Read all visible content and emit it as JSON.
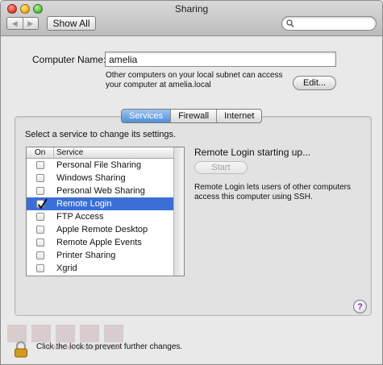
{
  "window": {
    "title": "Sharing"
  },
  "toolbar": {
    "show_all_label": "Show All",
    "search_placeholder": ""
  },
  "computer_name": {
    "label": "Computer Name:",
    "value": "amelia",
    "info_line1": "Other computers on your local subnet can access",
    "info_line2": "your computer at amelia.local",
    "edit_label": "Edit..."
  },
  "tabs": [
    {
      "label": "Services",
      "active": true
    },
    {
      "label": "Firewall",
      "active": false
    },
    {
      "label": "Internet",
      "active": false
    }
  ],
  "services_pane": {
    "prompt": "Select a service to change its settings.",
    "columns": {
      "on": "On",
      "service": "Service"
    },
    "rows": [
      {
        "label": "Personal File Sharing",
        "checked": false,
        "selected": false
      },
      {
        "label": "Windows Sharing",
        "checked": false,
        "selected": false
      },
      {
        "label": "Personal Web Sharing",
        "checked": false,
        "selected": false
      },
      {
        "label": "Remote Login",
        "checked": true,
        "selected": true
      },
      {
        "label": "FTP Access",
        "checked": false,
        "selected": false
      },
      {
        "label": "Apple Remote Desktop",
        "checked": false,
        "selected": false
      },
      {
        "label": "Remote Apple Events",
        "checked": false,
        "selected": false
      },
      {
        "label": "Printer Sharing",
        "checked": false,
        "selected": false
      },
      {
        "label": "Xgrid",
        "checked": false,
        "selected": false
      }
    ],
    "status": "Remote Login starting up...",
    "start_label": "Start",
    "description_line1": "Remote Login lets users of other computers",
    "description_line2": "access this computer using SSH."
  },
  "help_label": "?",
  "lock_text": "Click the lock to prevent further changes.",
  "watermark": "www.feverance.com",
  "colors": {
    "selection": "#3a6fd6",
    "help": "#6b2fc4"
  }
}
